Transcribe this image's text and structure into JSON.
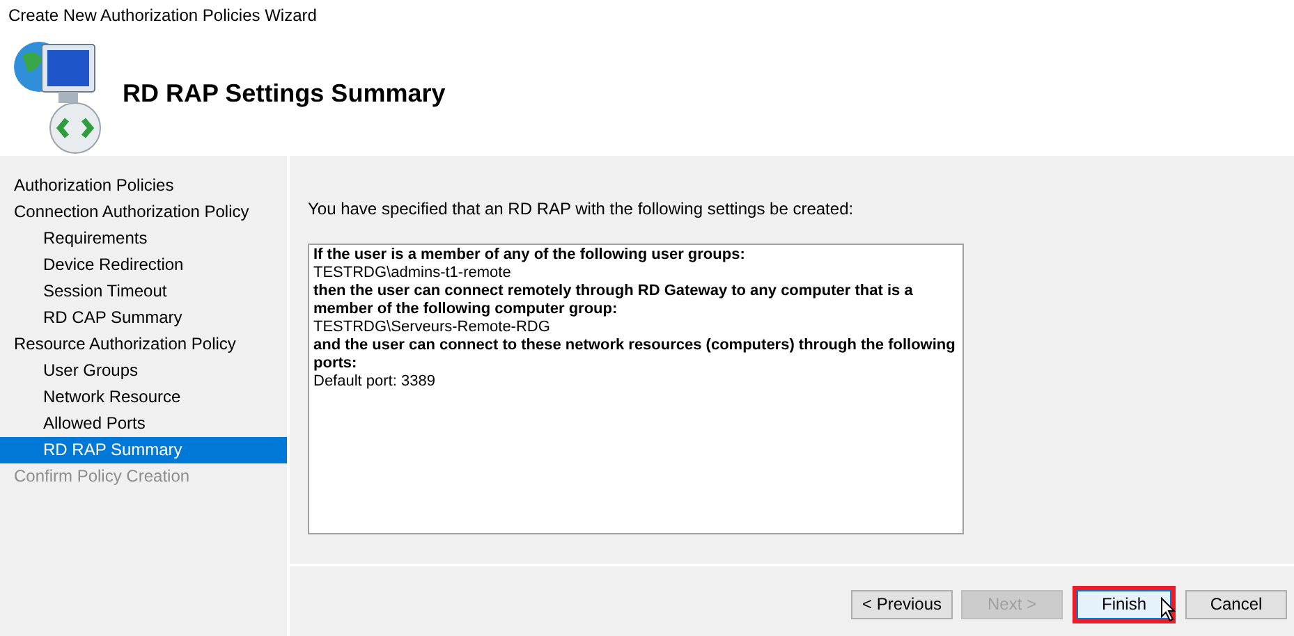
{
  "window": {
    "title": "Create New Authorization Policies Wizard"
  },
  "header": {
    "title": "RD RAP Settings Summary"
  },
  "sidebar": {
    "items": [
      {
        "label": "Authorization Policies",
        "selected": false,
        "disabled": false
      },
      {
        "label": "Connection Authorization Policy",
        "selected": false,
        "disabled": false,
        "children": [
          {
            "label": "Requirements",
            "selected": false,
            "disabled": false
          },
          {
            "label": "Device Redirection",
            "selected": false,
            "disabled": false
          },
          {
            "label": "Session Timeout",
            "selected": false,
            "disabled": false
          },
          {
            "label": "RD CAP Summary",
            "selected": false,
            "disabled": false
          }
        ]
      },
      {
        "label": "Resource Authorization Policy",
        "selected": false,
        "disabled": false,
        "children": [
          {
            "label": "User Groups",
            "selected": false,
            "disabled": false
          },
          {
            "label": "Network Resource",
            "selected": false,
            "disabled": false
          },
          {
            "label": "Allowed Ports",
            "selected": false,
            "disabled": false
          },
          {
            "label": "RD RAP Summary",
            "selected": true,
            "disabled": false
          }
        ]
      },
      {
        "label": "Confirm Policy Creation",
        "selected": false,
        "disabled": true
      }
    ]
  },
  "intro": "You have specified that an RD RAP with the following settings be created:",
  "summary": [
    {
      "kind": "heading",
      "text": "If the user is a member of any of the following user groups:"
    },
    {
      "kind": "value",
      "text": "TESTRDG\\admins-t1-remote"
    },
    {
      "kind": "heading",
      "text": "then the user can connect remotely through RD Gateway to any computer that is a member of the following computer group:"
    },
    {
      "kind": "value",
      "text": "TESTRDG\\Serveurs-Remote-RDG"
    },
    {
      "kind": "heading",
      "text": "and the user can connect to these network resources (computers) through the following ports:"
    },
    {
      "kind": "value",
      "text": "Default port: 3389"
    }
  ],
  "buttons": [
    {
      "label": "< Previous",
      "disabled": false,
      "highlighted": false
    },
    {
      "label": "Next >",
      "disabled": true,
      "highlighted": false
    },
    {
      "label": "Finish",
      "disabled": false,
      "highlighted": true
    },
    {
      "label": "Cancel",
      "disabled": false,
      "highlighted": false
    }
  ]
}
